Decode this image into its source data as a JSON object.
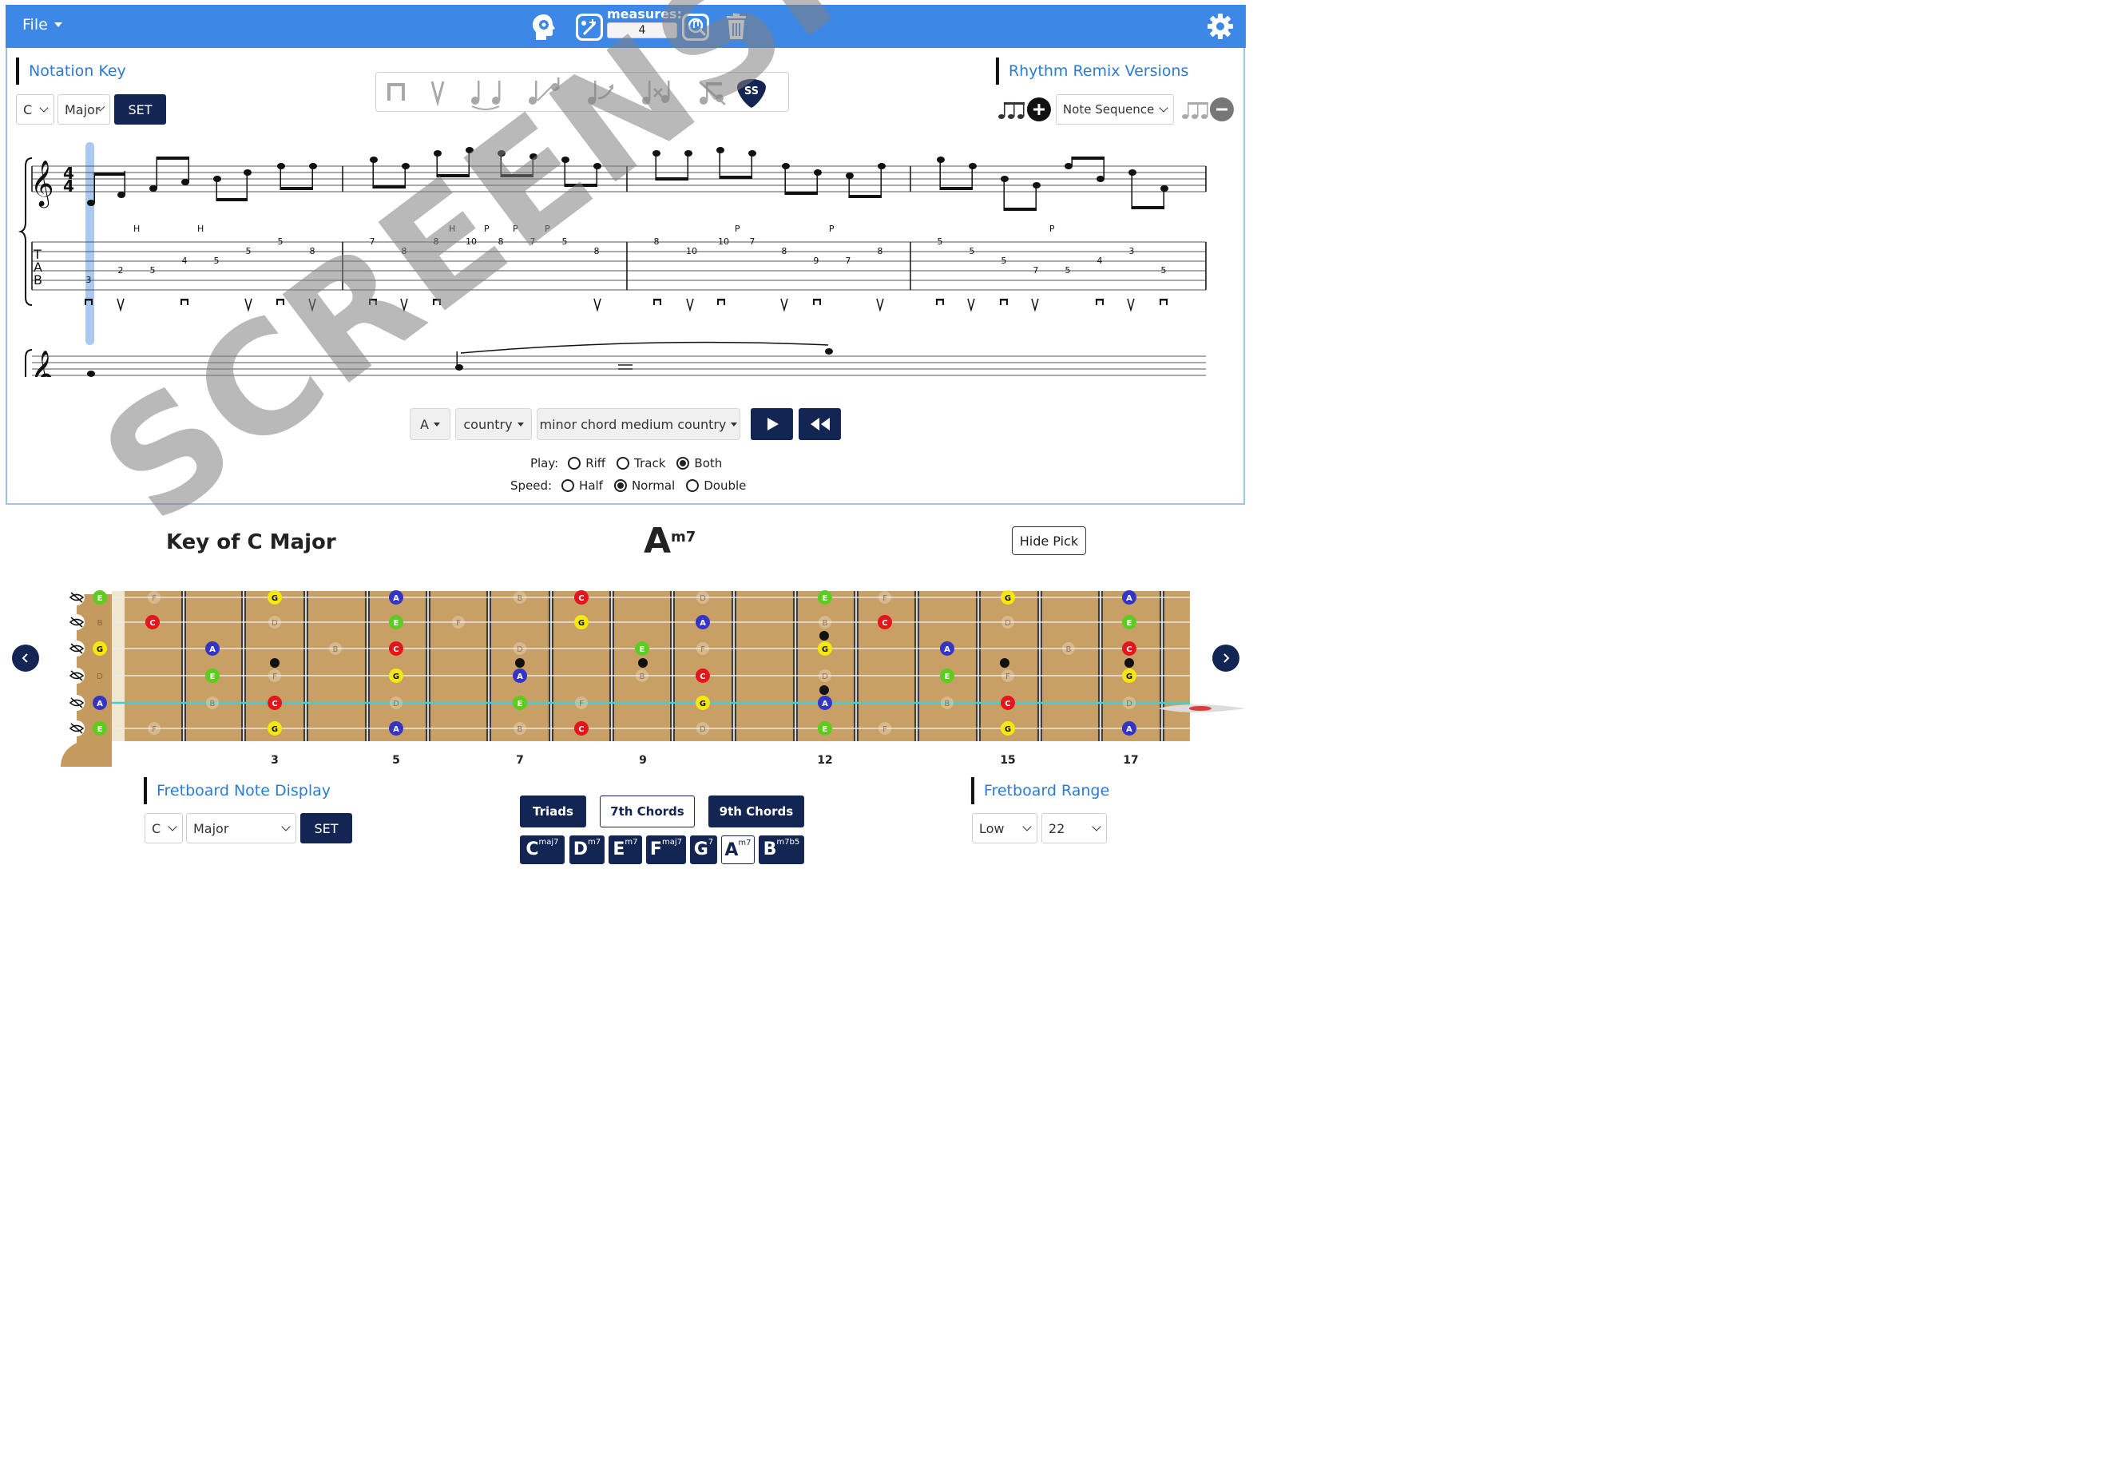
{
  "topbar": {
    "file_label": "File",
    "measures_label": "measures:",
    "measures_value": "4",
    "icons": [
      "brain-gear-icon",
      "wand-notes-icon",
      "music-search-icon",
      "trash-icon",
      "settings-gear-icon"
    ]
  },
  "notation_key": {
    "title": "Notation Key",
    "key": "C",
    "mode": "Major",
    "set_label": "SET"
  },
  "rhythm_remix": {
    "title": "Rhythm Remix Versions",
    "selected": "Note Sequence"
  },
  "tools": [
    "downstroke-icon",
    "upstroke-icon",
    "tie-icon",
    "slide-icon",
    "bend-icon",
    "mute-icon",
    "rest-icon",
    "ss-pick-icon"
  ],
  "sheet": {
    "time_sig_top": "4",
    "time_sig_bottom": "4",
    "tab_labels": [
      "T",
      "A",
      "B"
    ],
    "measures": [
      {
        "articulations": [
          "H",
          "H"
        ],
        "tab": [
          "3",
          "2",
          "5",
          "4",
          "5",
          "5",
          "5",
          "8"
        ]
      },
      {
        "articulations": [
          "H",
          "P",
          "P",
          "P"
        ],
        "tab": [
          "7",
          "8",
          "8",
          "10",
          "8",
          "7",
          "5",
          "8"
        ]
      },
      {
        "articulations": [
          "P",
          "P"
        ],
        "tab": [
          "8",
          "10",
          "10",
          "7",
          "8",
          "9",
          "7",
          "8"
        ]
      },
      {
        "articulations": [
          "P"
        ],
        "tab": [
          "5",
          "5",
          "5",
          "7",
          "5",
          "4",
          "3",
          "5"
        ]
      }
    ]
  },
  "playback": {
    "key": "A",
    "genre": "country",
    "track": "minor chord medium country",
    "play_label": "Play:",
    "play_options": [
      "Riff",
      "Track",
      "Both"
    ],
    "play_selected": "Both",
    "speed_label": "Speed:",
    "speed_options": [
      "Half",
      "Normal",
      "Double"
    ],
    "speed_selected": "Normal"
  },
  "fretboard": {
    "key_title": "Key of C Major",
    "chord_root": "A",
    "chord_quality": "m7",
    "hide_pick_label": "Hide Pick",
    "fret_numbers": [
      "3",
      "5",
      "7",
      "9",
      "12",
      "15",
      "17"
    ],
    "open_strings": [
      "E",
      "B",
      "G",
      "D",
      "A",
      "E"
    ]
  },
  "fretboard_note_display": {
    "title": "Fretboard Note Display",
    "key": "C",
    "mode": "Major",
    "set_label": "SET"
  },
  "chord_types": {
    "triads": "Triads",
    "seventh": "7th Chords",
    "ninth": "9th Chords"
  },
  "chords": [
    {
      "root": "C",
      "quality": "maj7"
    },
    {
      "root": "D",
      "quality": "m7"
    },
    {
      "root": "E",
      "quality": "m7"
    },
    {
      "root": "F",
      "quality": "maj7"
    },
    {
      "root": "G",
      "quality": "7"
    },
    {
      "root": "A",
      "quality": "m7"
    },
    {
      "root": "B",
      "quality": "m7b5"
    }
  ],
  "fretboard_range": {
    "title": "Fretboard Range",
    "low": "Low",
    "high": "22"
  },
  "watermark": "SCREENSHOT",
  "colors": {
    "topbar": "#3d87e6",
    "accent": "#2b7bd6",
    "navy": "#132552",
    "note_C": "#e8141b",
    "note_E": "#5ccc21",
    "note_G": "#f6e70e",
    "note_A": "#3434c8"
  }
}
